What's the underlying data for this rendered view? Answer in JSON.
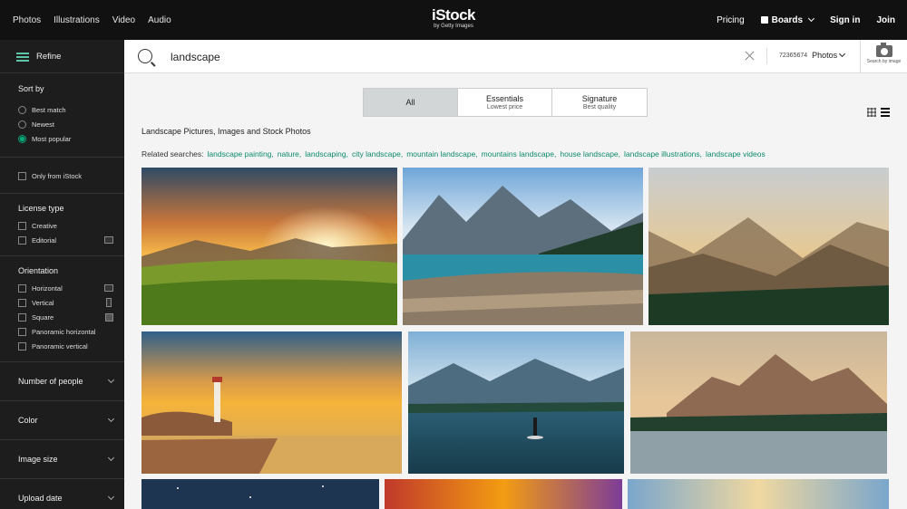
{
  "nav": {
    "links": [
      "Photos",
      "Illustrations",
      "Video",
      "Audio"
    ],
    "logo": "iStock",
    "logo_sub": "by Getty Images",
    "pricing": "Pricing",
    "boards": "Boards",
    "signin": "Sign in",
    "join": "Join"
  },
  "search": {
    "value": "landscape",
    "media_count": "72365674",
    "media_type": "Photos",
    "search_by_image": "Search by image"
  },
  "sidebar": {
    "refine": "Refine",
    "sort_by": {
      "title": "Sort by",
      "options": [
        "Best match",
        "Newest",
        "Most popular"
      ],
      "selected": "Most popular"
    },
    "only_from": "Only from iStock",
    "license": {
      "title": "License type",
      "options": [
        "Creative",
        "Editorial"
      ]
    },
    "orientation": {
      "title": "Orientation",
      "options": [
        "Horizontal",
        "Vertical",
        "Square",
        "Panoramic horizontal",
        "Panoramic vertical"
      ]
    },
    "collapsibles": [
      "Number of people",
      "Color",
      "Image size",
      "Upload date"
    ]
  },
  "tabs": [
    {
      "label": "All",
      "sub": ""
    },
    {
      "label": "Essentials",
      "sub": "Lowest price"
    },
    {
      "label": "Signature",
      "sub": "Best quality"
    }
  ],
  "page_title": "Landscape Pictures, Images and Stock Photos",
  "related": {
    "label": "Related searches:",
    "items": [
      "landscape painting,",
      "nature,",
      "landscaping,",
      "city landscape,",
      "mountain landscape,",
      "mountains landscape,",
      "house landscape,",
      "landscape illustrations,",
      "landscape videos"
    ]
  },
  "colors": {
    "accent": "#0b8a6a",
    "nav_bg": "#111111",
    "sidebar_bg": "#1d1d1d"
  }
}
